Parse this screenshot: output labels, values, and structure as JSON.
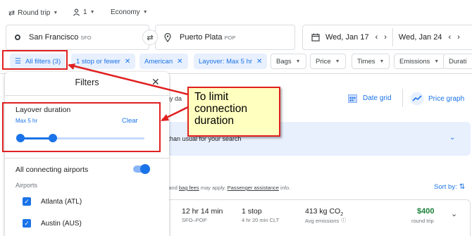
{
  "trip": {
    "type": "Round trip",
    "passengers": "1",
    "cabin": "Economy"
  },
  "search": {
    "origin": "San Francisco",
    "origin_code": "SFO",
    "destination": "Puerto Plata",
    "destination_code": "POP",
    "depart_date": "Wed, Jan 17",
    "return_date": "Wed, Jan 24"
  },
  "chips": {
    "all_filters": "All filters (3)",
    "stops": "1 stop or fewer",
    "airline": "American",
    "layover": "Layover: Max 5 hr",
    "bags": "Bags",
    "price": "Price",
    "times": "Times",
    "emissions": "Emissions",
    "duration": "Durati"
  },
  "filters_panel": {
    "title": "Filters",
    "layover_heading": "Layover duration",
    "layover_value": "Max 5 hr",
    "clear_label": "Clear",
    "slider_level": 0.15,
    "connecting_label": "All connecting airports",
    "airports_heading": "Airports",
    "airports": [
      "Atlanta (ATL)",
      "Austin (AUS)"
    ]
  },
  "results": {
    "tab_fragment": "ny da",
    "date_grid": "Date grid",
    "price_graph": "Price graph",
    "notice_fragment": "r than usual for your search",
    "fees_fragment": "n and",
    "bag_fees": "bag fees",
    "fees_mid": "may apply.",
    "assistance": "Passenger assistance",
    "fees_end": "info.",
    "sort_label": "Sort by:",
    "flight": {
      "duration": "12 hr 14 min",
      "route": "SFO–POP",
      "stops": "1 stop",
      "layover": "4 hr 20 min CLT",
      "emissions": "413 kg CO",
      "emissions_sub": "2",
      "emissions_label": "Avg emissions",
      "price": "$400",
      "price_label": "round trip"
    }
  },
  "annotation": {
    "text": "To limit connection duration"
  },
  "colors": {
    "accent": "#1a73e8",
    "chip_bg": "#e8f0fe",
    "annotation_red": "#e02020",
    "callout_bg": "#ffffc0",
    "price_green": "#188038"
  }
}
